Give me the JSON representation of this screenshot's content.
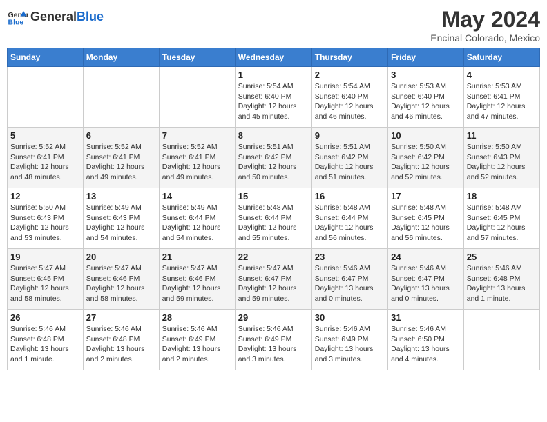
{
  "logo": {
    "general": "General",
    "blue": "Blue"
  },
  "title": "May 2024",
  "location": "Encinal Colorado, Mexico",
  "days_header": [
    "Sunday",
    "Monday",
    "Tuesday",
    "Wednesday",
    "Thursday",
    "Friday",
    "Saturday"
  ],
  "weeks": [
    [
      {
        "day": "",
        "info": ""
      },
      {
        "day": "",
        "info": ""
      },
      {
        "day": "",
        "info": ""
      },
      {
        "day": "1",
        "info": "Sunrise: 5:54 AM\nSunset: 6:40 PM\nDaylight: 12 hours\nand 45 minutes."
      },
      {
        "day": "2",
        "info": "Sunrise: 5:54 AM\nSunset: 6:40 PM\nDaylight: 12 hours\nand 46 minutes."
      },
      {
        "day": "3",
        "info": "Sunrise: 5:53 AM\nSunset: 6:40 PM\nDaylight: 12 hours\nand 46 minutes."
      },
      {
        "day": "4",
        "info": "Sunrise: 5:53 AM\nSunset: 6:41 PM\nDaylight: 12 hours\nand 47 minutes."
      }
    ],
    [
      {
        "day": "5",
        "info": "Sunrise: 5:52 AM\nSunset: 6:41 PM\nDaylight: 12 hours\nand 48 minutes."
      },
      {
        "day": "6",
        "info": "Sunrise: 5:52 AM\nSunset: 6:41 PM\nDaylight: 12 hours\nand 49 minutes."
      },
      {
        "day": "7",
        "info": "Sunrise: 5:52 AM\nSunset: 6:41 PM\nDaylight: 12 hours\nand 49 minutes."
      },
      {
        "day": "8",
        "info": "Sunrise: 5:51 AM\nSunset: 6:42 PM\nDaylight: 12 hours\nand 50 minutes."
      },
      {
        "day": "9",
        "info": "Sunrise: 5:51 AM\nSunset: 6:42 PM\nDaylight: 12 hours\nand 51 minutes."
      },
      {
        "day": "10",
        "info": "Sunrise: 5:50 AM\nSunset: 6:42 PM\nDaylight: 12 hours\nand 52 minutes."
      },
      {
        "day": "11",
        "info": "Sunrise: 5:50 AM\nSunset: 6:43 PM\nDaylight: 12 hours\nand 52 minutes."
      }
    ],
    [
      {
        "day": "12",
        "info": "Sunrise: 5:50 AM\nSunset: 6:43 PM\nDaylight: 12 hours\nand 53 minutes."
      },
      {
        "day": "13",
        "info": "Sunrise: 5:49 AM\nSunset: 6:43 PM\nDaylight: 12 hours\nand 54 minutes."
      },
      {
        "day": "14",
        "info": "Sunrise: 5:49 AM\nSunset: 6:44 PM\nDaylight: 12 hours\nand 54 minutes."
      },
      {
        "day": "15",
        "info": "Sunrise: 5:48 AM\nSunset: 6:44 PM\nDaylight: 12 hours\nand 55 minutes."
      },
      {
        "day": "16",
        "info": "Sunrise: 5:48 AM\nSunset: 6:44 PM\nDaylight: 12 hours\nand 56 minutes."
      },
      {
        "day": "17",
        "info": "Sunrise: 5:48 AM\nSunset: 6:45 PM\nDaylight: 12 hours\nand 56 minutes."
      },
      {
        "day": "18",
        "info": "Sunrise: 5:48 AM\nSunset: 6:45 PM\nDaylight: 12 hours\nand 57 minutes."
      }
    ],
    [
      {
        "day": "19",
        "info": "Sunrise: 5:47 AM\nSunset: 6:45 PM\nDaylight: 12 hours\nand 58 minutes."
      },
      {
        "day": "20",
        "info": "Sunrise: 5:47 AM\nSunset: 6:46 PM\nDaylight: 12 hours\nand 58 minutes."
      },
      {
        "day": "21",
        "info": "Sunrise: 5:47 AM\nSunset: 6:46 PM\nDaylight: 12 hours\nand 59 minutes."
      },
      {
        "day": "22",
        "info": "Sunrise: 5:47 AM\nSunset: 6:47 PM\nDaylight: 12 hours\nand 59 minutes."
      },
      {
        "day": "23",
        "info": "Sunrise: 5:46 AM\nSunset: 6:47 PM\nDaylight: 13 hours\nand 0 minutes."
      },
      {
        "day": "24",
        "info": "Sunrise: 5:46 AM\nSunset: 6:47 PM\nDaylight: 13 hours\nand 0 minutes."
      },
      {
        "day": "25",
        "info": "Sunrise: 5:46 AM\nSunset: 6:48 PM\nDaylight: 13 hours\nand 1 minute."
      }
    ],
    [
      {
        "day": "26",
        "info": "Sunrise: 5:46 AM\nSunset: 6:48 PM\nDaylight: 13 hours\nand 1 minute."
      },
      {
        "day": "27",
        "info": "Sunrise: 5:46 AM\nSunset: 6:48 PM\nDaylight: 13 hours\nand 2 minutes."
      },
      {
        "day": "28",
        "info": "Sunrise: 5:46 AM\nSunset: 6:49 PM\nDaylight: 13 hours\nand 2 minutes."
      },
      {
        "day": "29",
        "info": "Sunrise: 5:46 AM\nSunset: 6:49 PM\nDaylight: 13 hours\nand 3 minutes."
      },
      {
        "day": "30",
        "info": "Sunrise: 5:46 AM\nSunset: 6:49 PM\nDaylight: 13 hours\nand 3 minutes."
      },
      {
        "day": "31",
        "info": "Sunrise: 5:46 AM\nSunset: 6:50 PM\nDaylight: 13 hours\nand 4 minutes."
      },
      {
        "day": "",
        "info": ""
      }
    ]
  ]
}
